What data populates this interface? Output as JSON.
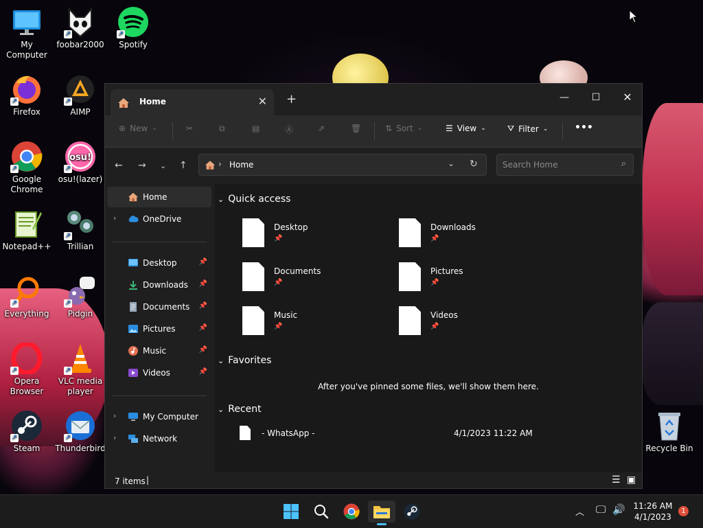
{
  "desktop": {
    "icons": [
      {
        "label": "My Computer"
      },
      {
        "label": "foobar2000"
      },
      {
        "label": "Spotify"
      },
      {
        "label": "Firefox"
      },
      {
        "label": "AIMP"
      },
      {
        "label": "Google Chrome"
      },
      {
        "label": "osu!(lazer)"
      },
      {
        "label": "Notepad++"
      },
      {
        "label": "Trillian"
      },
      {
        "label": "Everything"
      },
      {
        "label": "Pidgin"
      },
      {
        "label": "Opera Browser"
      },
      {
        "label": "VLC media player"
      },
      {
        "label": "Steam"
      },
      {
        "label": "Thunderbird"
      },
      {
        "label": "Recycle Bin"
      }
    ]
  },
  "explorer": {
    "tab_title": "Home",
    "commands": {
      "new": "New",
      "sort": "Sort",
      "view": "View",
      "filter": "Filter"
    },
    "breadcrumb": "Home",
    "search_placeholder": "Search Home",
    "nav": {
      "home": "Home",
      "onedrive": "OneDrive",
      "desktop": "Desktop",
      "downloads": "Downloads",
      "documents": "Documents",
      "pictures": "Pictures",
      "music": "Music",
      "videos": "Videos",
      "my_computer": "My Computer",
      "network": "Network"
    },
    "sections": {
      "quick_access": "Quick access",
      "favorites": "Favorites",
      "favorites_empty": "After you've pinned some files, we'll show them here.",
      "recent": "Recent"
    },
    "quick_access": [
      {
        "label": "Desktop"
      },
      {
        "label": "Downloads"
      },
      {
        "label": "Documents"
      },
      {
        "label": "Pictures"
      },
      {
        "label": "Music"
      },
      {
        "label": "Videos"
      }
    ],
    "recent": [
      {
        "name": "- WhatsApp -",
        "date": "4/1/2023 11:22 AM"
      }
    ],
    "status": "7 items"
  },
  "taskbar": {
    "time": "11:26 AM",
    "date": "4/1/2023",
    "notification_count": "1"
  },
  "colors": {
    "accent": "#0078d4",
    "folder_yellow": "#f4c542",
    "badge": "#e0503a"
  }
}
